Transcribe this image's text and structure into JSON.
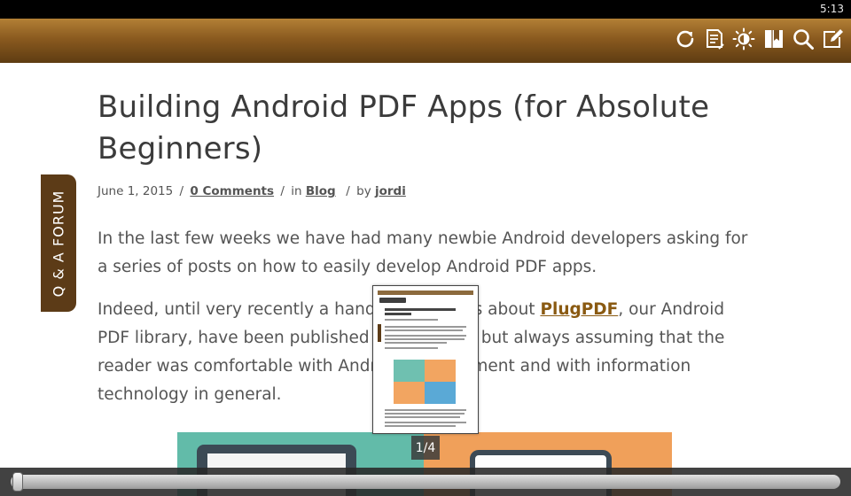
{
  "status_bar": {
    "time": "5:13"
  },
  "toolbar": {
    "buttons": [
      {
        "icon": "refresh-icon"
      },
      {
        "icon": "notes-icon"
      },
      {
        "icon": "brightness-icon"
      },
      {
        "icon": "bookmark-icon"
      },
      {
        "icon": "search-icon"
      },
      {
        "icon": "edit-icon"
      }
    ],
    "colors": {
      "gradient_top": "#b38036",
      "gradient_bottom": "#5e3c12",
      "icon": "#ffffff"
    }
  },
  "side_tab": {
    "label": "Q & A FORUM",
    "color": "#5c3b17"
  },
  "article": {
    "title": "Building Android PDF Apps (for Absolute Beginners)",
    "meta": {
      "date": "June 1, 2015",
      "separator": "/",
      "comments": "0 Comments",
      "in_prefix": "in",
      "category": "Blog",
      "by_prefix": "by",
      "author": "jordi"
    },
    "paragraph1": "In the last few weeks we have had many newbie Android developers asking for a series of posts on how to easily develop Android PDF apps.",
    "paragraph2": {
      "before": "Indeed, until very recently a handful of articles about ",
      "link": "PlugPDF",
      "after": ", our Android PDF library, have been published on this blog, but always assuming that the reader was comfortable with Android development and with information technology in general."
    },
    "link_color": "#8a5a12"
  },
  "viewer": {
    "page_indicator": "1/4",
    "seek_position": 0.0
  }
}
